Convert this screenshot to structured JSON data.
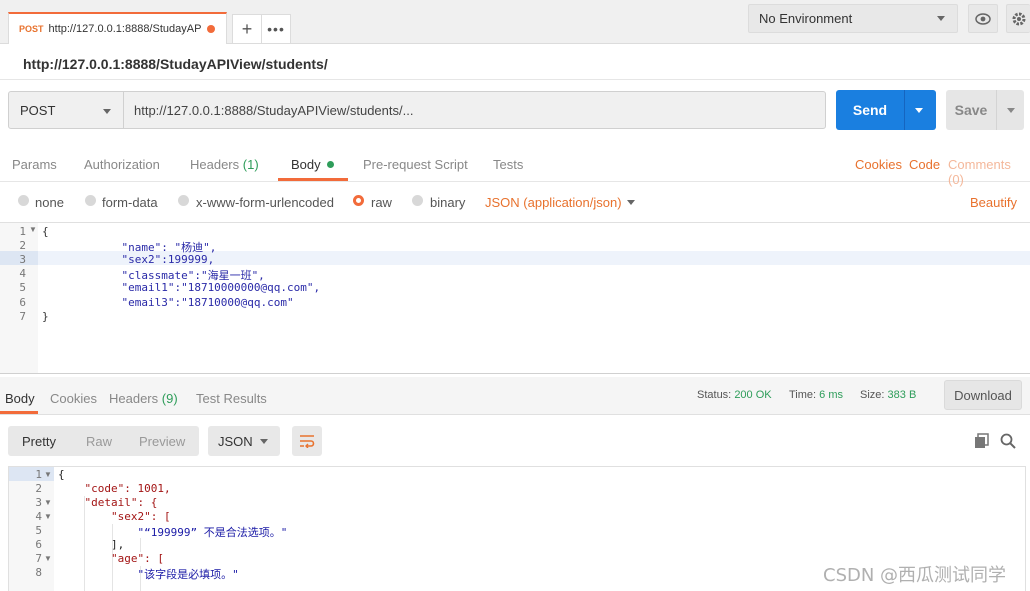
{
  "tab": {
    "method": "POST",
    "url": "http://127.0.0.1:8888/StudayAP"
  },
  "environment": {
    "selected": "No Environment"
  },
  "request_title": "http://127.0.0.1:8888/StudayAPIView/students/",
  "request": {
    "method": "POST",
    "url": "http://127.0.0.1:8888/StudayAPIView/students/...",
    "send_label": "Send",
    "save_label": "Save"
  },
  "request_tabs": {
    "params": "Params",
    "authorization": "Authorization",
    "headers": "Headers",
    "headers_count": "(1)",
    "body": "Body",
    "prerequest": "Pre-request Script",
    "tests": "Tests",
    "cookies": "Cookies",
    "code": "Code",
    "comments": "Comments (0)"
  },
  "body_modes": {
    "none": "none",
    "form_data": "form-data",
    "urlencoded": "x-www-form-urlencoded",
    "raw": "raw",
    "binary": "binary",
    "json_type": "JSON (application/json)",
    "beautify": "Beautify"
  },
  "request_body": {
    "line_numbers": [
      "1",
      "2",
      "3",
      "4",
      "5",
      "6",
      "7"
    ],
    "lines": [
      "{",
      "            \"name\": \"杨迪\",",
      "            \"sex2\":199999,",
      "            \"classmate\":\"海星一班\",",
      "            \"email1\":\"18710000000@qq.com\",",
      "            \"email3\":\"18710000@qq.com\"",
      "}"
    ]
  },
  "response_tabs": {
    "body": "Body",
    "cookies": "Cookies",
    "headers": "Headers",
    "headers_count": "(9)",
    "test_results": "Test Results"
  },
  "response_meta": {
    "status_label": "Status:",
    "status_value": "200 OK",
    "time_label": "Time:",
    "time_value": "6 ms",
    "size_label": "Size:",
    "size_value": "383 B",
    "download": "Download"
  },
  "response_toolbar": {
    "pretty": "Pretty",
    "raw": "Raw",
    "preview": "Preview",
    "format": "JSON"
  },
  "response_body": {
    "line_numbers": [
      "1",
      "2",
      "3",
      "4",
      "5",
      "6",
      "7",
      "8"
    ],
    "lines": [
      "{",
      "    \"code\": 1001,",
      "    \"detail\": {",
      "        \"sex2\": [",
      "            \"“199999” 不是合法选项。\"",
      "        ],",
      "        \"age\": [",
      "            \"该字段是必填项。\""
    ]
  },
  "watermark": "CSDN @西瓜测试同学"
}
